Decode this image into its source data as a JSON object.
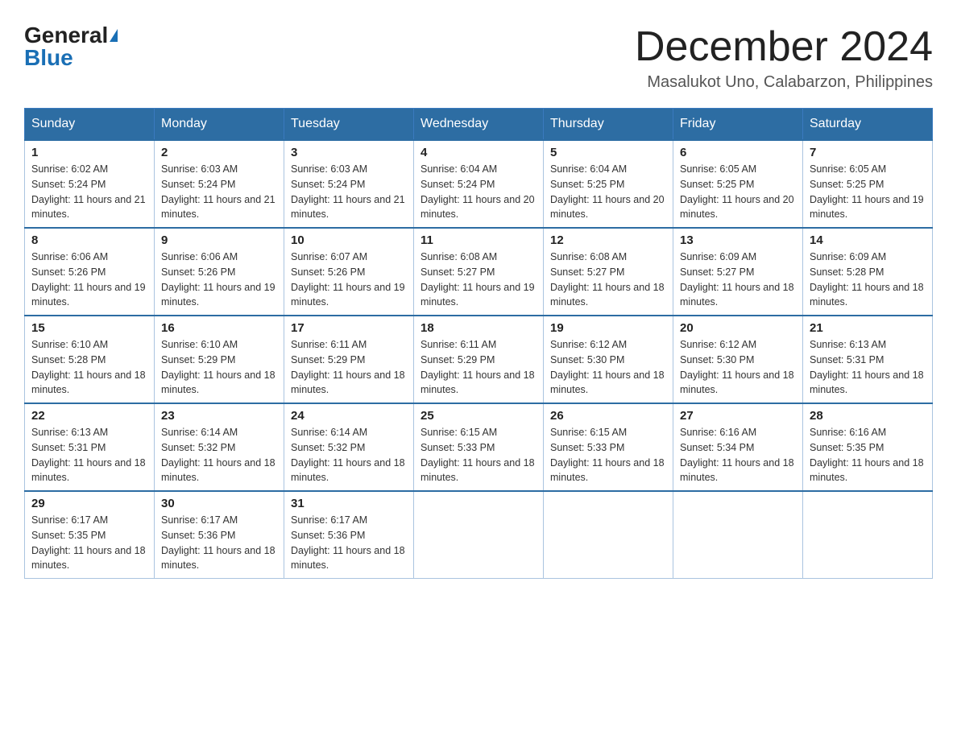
{
  "header": {
    "logo_general": "General",
    "logo_blue": "Blue",
    "month_title": "December 2024",
    "location": "Masalukot Uno, Calabarzon, Philippines"
  },
  "weekdays": [
    "Sunday",
    "Monday",
    "Tuesday",
    "Wednesday",
    "Thursday",
    "Friday",
    "Saturday"
  ],
  "weeks": [
    [
      {
        "day": "1",
        "sunrise": "6:02 AM",
        "sunset": "5:24 PM",
        "daylight": "11 hours and 21 minutes."
      },
      {
        "day": "2",
        "sunrise": "6:03 AM",
        "sunset": "5:24 PM",
        "daylight": "11 hours and 21 minutes."
      },
      {
        "day": "3",
        "sunrise": "6:03 AM",
        "sunset": "5:24 PM",
        "daylight": "11 hours and 21 minutes."
      },
      {
        "day": "4",
        "sunrise": "6:04 AM",
        "sunset": "5:24 PM",
        "daylight": "11 hours and 20 minutes."
      },
      {
        "day": "5",
        "sunrise": "6:04 AM",
        "sunset": "5:25 PM",
        "daylight": "11 hours and 20 minutes."
      },
      {
        "day": "6",
        "sunrise": "6:05 AM",
        "sunset": "5:25 PM",
        "daylight": "11 hours and 20 minutes."
      },
      {
        "day": "7",
        "sunrise": "6:05 AM",
        "sunset": "5:25 PM",
        "daylight": "11 hours and 19 minutes."
      }
    ],
    [
      {
        "day": "8",
        "sunrise": "6:06 AM",
        "sunset": "5:26 PM",
        "daylight": "11 hours and 19 minutes."
      },
      {
        "day": "9",
        "sunrise": "6:06 AM",
        "sunset": "5:26 PM",
        "daylight": "11 hours and 19 minutes."
      },
      {
        "day": "10",
        "sunrise": "6:07 AM",
        "sunset": "5:26 PM",
        "daylight": "11 hours and 19 minutes."
      },
      {
        "day": "11",
        "sunrise": "6:08 AM",
        "sunset": "5:27 PM",
        "daylight": "11 hours and 19 minutes."
      },
      {
        "day": "12",
        "sunrise": "6:08 AM",
        "sunset": "5:27 PM",
        "daylight": "11 hours and 18 minutes."
      },
      {
        "day": "13",
        "sunrise": "6:09 AM",
        "sunset": "5:27 PM",
        "daylight": "11 hours and 18 minutes."
      },
      {
        "day": "14",
        "sunrise": "6:09 AM",
        "sunset": "5:28 PM",
        "daylight": "11 hours and 18 minutes."
      }
    ],
    [
      {
        "day": "15",
        "sunrise": "6:10 AM",
        "sunset": "5:28 PM",
        "daylight": "11 hours and 18 minutes."
      },
      {
        "day": "16",
        "sunrise": "6:10 AM",
        "sunset": "5:29 PM",
        "daylight": "11 hours and 18 minutes."
      },
      {
        "day": "17",
        "sunrise": "6:11 AM",
        "sunset": "5:29 PM",
        "daylight": "11 hours and 18 minutes."
      },
      {
        "day": "18",
        "sunrise": "6:11 AM",
        "sunset": "5:29 PM",
        "daylight": "11 hours and 18 minutes."
      },
      {
        "day": "19",
        "sunrise": "6:12 AM",
        "sunset": "5:30 PM",
        "daylight": "11 hours and 18 minutes."
      },
      {
        "day": "20",
        "sunrise": "6:12 AM",
        "sunset": "5:30 PM",
        "daylight": "11 hours and 18 minutes."
      },
      {
        "day": "21",
        "sunrise": "6:13 AM",
        "sunset": "5:31 PM",
        "daylight": "11 hours and 18 minutes."
      }
    ],
    [
      {
        "day": "22",
        "sunrise": "6:13 AM",
        "sunset": "5:31 PM",
        "daylight": "11 hours and 18 minutes."
      },
      {
        "day": "23",
        "sunrise": "6:14 AM",
        "sunset": "5:32 PM",
        "daylight": "11 hours and 18 minutes."
      },
      {
        "day": "24",
        "sunrise": "6:14 AM",
        "sunset": "5:32 PM",
        "daylight": "11 hours and 18 minutes."
      },
      {
        "day": "25",
        "sunrise": "6:15 AM",
        "sunset": "5:33 PM",
        "daylight": "11 hours and 18 minutes."
      },
      {
        "day": "26",
        "sunrise": "6:15 AM",
        "sunset": "5:33 PM",
        "daylight": "11 hours and 18 minutes."
      },
      {
        "day": "27",
        "sunrise": "6:16 AM",
        "sunset": "5:34 PM",
        "daylight": "11 hours and 18 minutes."
      },
      {
        "day": "28",
        "sunrise": "6:16 AM",
        "sunset": "5:35 PM",
        "daylight": "11 hours and 18 minutes."
      }
    ],
    [
      {
        "day": "29",
        "sunrise": "6:17 AM",
        "sunset": "5:35 PM",
        "daylight": "11 hours and 18 minutes."
      },
      {
        "day": "30",
        "sunrise": "6:17 AM",
        "sunset": "5:36 PM",
        "daylight": "11 hours and 18 minutes."
      },
      {
        "day": "31",
        "sunrise": "6:17 AM",
        "sunset": "5:36 PM",
        "daylight": "11 hours and 18 minutes."
      },
      null,
      null,
      null,
      null
    ]
  ]
}
